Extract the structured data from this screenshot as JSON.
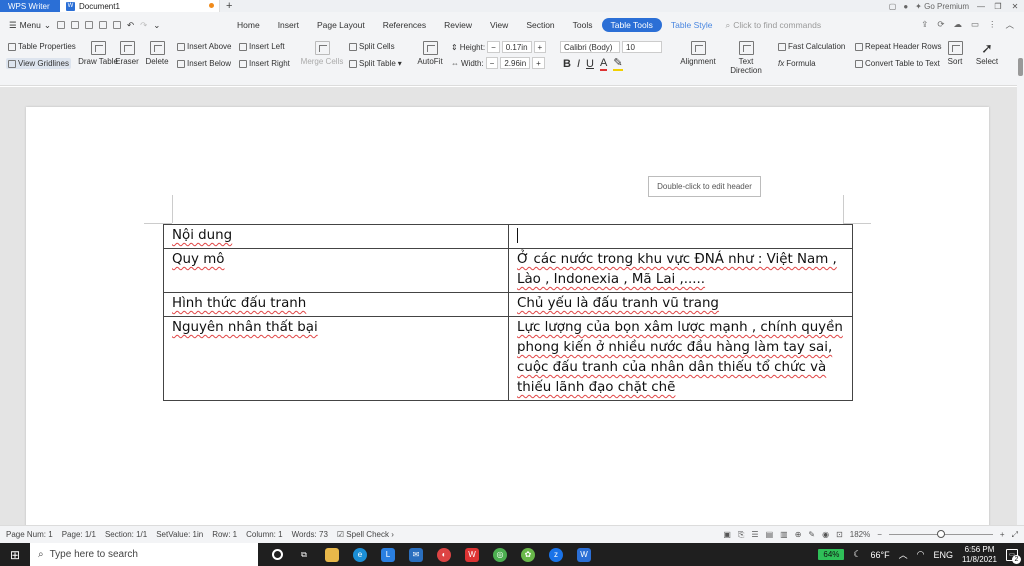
{
  "titlebar": {
    "app_name": "WPS Writer",
    "doc_name": "Document1",
    "new_tab": "+",
    "go_premium": "Go Premium",
    "minimize": "—",
    "restore": "❐",
    "close": "✕"
  },
  "menu": {
    "label": "Menu",
    "tabs": [
      "Home",
      "Insert",
      "Page Layout",
      "References",
      "Review",
      "View",
      "Section",
      "Tools",
      "Table Tools",
      "Table Style"
    ],
    "active_tab": "Table Tools",
    "find_placeholder": "Click to find commands"
  },
  "ribbon": {
    "table_properties": "Table Properties",
    "view_gridlines": "View Gridlines",
    "draw_table": "Draw Table",
    "eraser": "Eraser",
    "delete": "Delete",
    "insert_above": "Insert Above",
    "insert_below": "Insert Below",
    "insert_left": "Insert Left",
    "insert_right": "Insert Right",
    "merge_cells": "Merge Cells",
    "split_cells": "Split Cells",
    "split_table": "Split Table",
    "autofit": "AutoFit",
    "height_label": "Height:",
    "height_value": "0.17in",
    "width_label": "Width:",
    "width_value": "2.96in",
    "font_name": "Calibri (Body)",
    "font_size": "10",
    "alignment": "Alignment",
    "text_direction": "Text Direction",
    "fast_calculation": "Fast Calculation",
    "formula": "Formula",
    "repeat_header_rows": "Repeat Header Rows",
    "convert_table_to_text": "Convert Table to Text",
    "sort": "Sort",
    "select": "Select"
  },
  "document": {
    "header_hint": "Double-click to edit header",
    "table": [
      {
        "c1": "Nội dung",
        "c2": ""
      },
      {
        "c1": "Quy mô",
        "c2": "Ở các nước trong khu vực ĐNÁ như : Việt Nam , Lào , Indonexia , Mã Lai ,....."
      },
      {
        "c1": "Hình thức đấu tranh",
        "c2": "Chủ yếu là đấu tranh vũ trang"
      },
      {
        "c1": "Nguyên nhân thất bại",
        "c2": "Lực lượng của bọn xâm lược mạnh , chính quyền phong kiến ở nhiều nước đầu hàng làm tay sai, cuộc đấu tranh của nhân dân thiếu tổ chức và thiếu lãnh đạo chặt chẽ"
      }
    ]
  },
  "status": {
    "page_num": "Page Num: 1",
    "page": "Page: 1/1",
    "section": "Section: 1/1",
    "set_value": "SetValue: 1in",
    "row": "Row: 1",
    "column": "Column: 1",
    "words": "Words: 73",
    "spell_check": "Spell Check",
    "zoom": "182%",
    "zoom_level": 0.5
  },
  "taskbar": {
    "search_placeholder": "Type here to search",
    "battery": "64%",
    "weather": "66°F",
    "language": "ENG",
    "time": "6:56 PM",
    "date": "11/8/2021",
    "notifications": "2"
  },
  "colors": {
    "accent": "#2b6fd6",
    "spell_underline": "#e04545",
    "battery": "#2fbf58"
  }
}
